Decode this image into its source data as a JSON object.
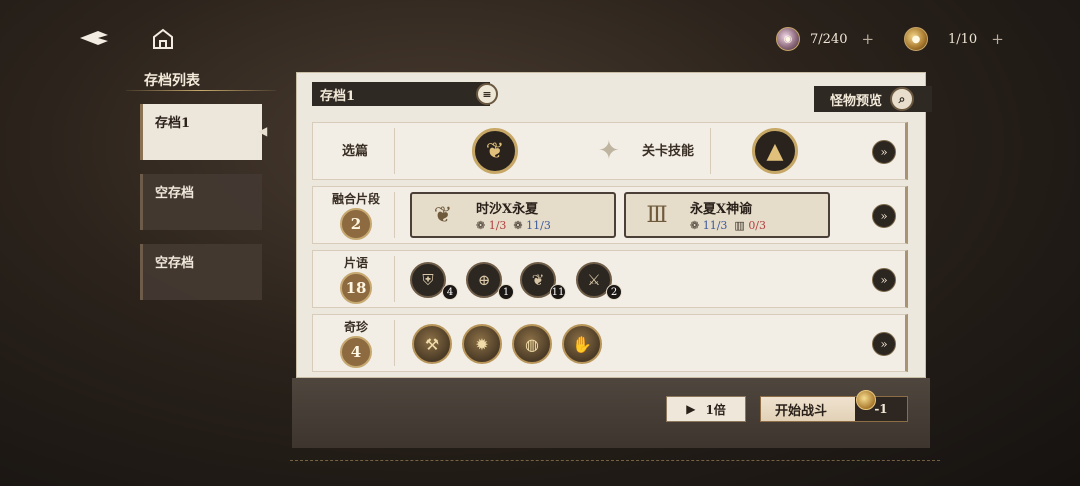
{
  "topbar": {
    "back_icon": "back-arrow-icon",
    "home_icon": "home-icon",
    "stamina": {
      "value": "7/240",
      "plus": "+"
    },
    "tickets": {
      "value": "1/10",
      "plus": "+"
    }
  },
  "save_list": {
    "title": "存档列表",
    "slots": [
      {
        "label": "存档1"
      },
      {
        "label": "空存档"
      },
      {
        "label": "空存档"
      }
    ]
  },
  "panel": {
    "save_name": "存档1",
    "monster_preview": "怪物预览",
    "selection": {
      "chapter_label": "选篇",
      "skill_label": "关卡技能"
    },
    "fusion": {
      "label": "融合片段",
      "count": "2",
      "cards": [
        {
          "name": "时沙X永夏",
          "stat1": "1/3",
          "stat2": "11/3"
        },
        {
          "name": "永夏X神谕",
          "stat1": "11/3",
          "stat2": "0/3"
        }
      ]
    },
    "phrases": {
      "label": "片语",
      "count": "18",
      "badges": [
        "4",
        "1",
        "11",
        "2"
      ]
    },
    "relics": {
      "label": "奇珍",
      "count": "4"
    }
  },
  "actions": {
    "speed": "1倍",
    "start": "开始战斗",
    "cost": "-1"
  }
}
